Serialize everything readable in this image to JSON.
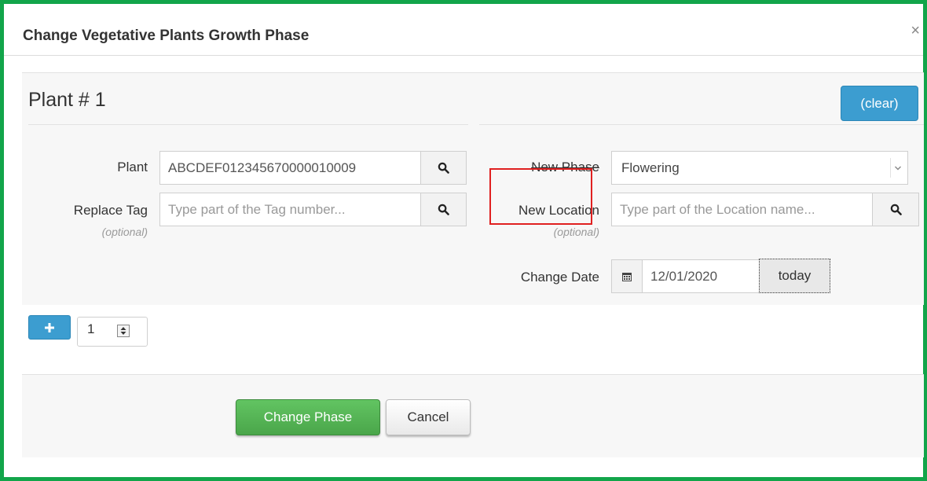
{
  "dialog": {
    "title": "Change Vegetative Plants Growth Phase",
    "close_symbol": "×"
  },
  "plant_section": {
    "heading": "Plant # 1",
    "clear_label": "(clear)"
  },
  "fields": {
    "plant": {
      "label": "Plant",
      "value": "ABCDEF012345670000010009"
    },
    "replace_tag": {
      "label": "Replace Tag",
      "optional": "(optional)",
      "placeholder": "Type part of the Tag number..."
    },
    "new_phase": {
      "label": "New Phase",
      "selected": "Flowering"
    },
    "new_location": {
      "label": "New Location",
      "optional": "(optional)",
      "placeholder": "Type part of the Location name..."
    },
    "change_date": {
      "label": "Change Date",
      "value": "12/01/2020",
      "today_label": "today"
    }
  },
  "add_rows": {
    "count": "1"
  },
  "footer": {
    "change_label": "Change Phase",
    "cancel_label": "Cancel"
  },
  "colors": {
    "frame_border": "#12a54a",
    "info_blue": "#3c9dd0",
    "success_green": "#4aa64a",
    "highlight_red": "#e02020"
  },
  "icons": {
    "search": "search-icon",
    "calendar": "calendar-icon",
    "plus": "plus-icon",
    "caret": "chevron-down-icon",
    "spin": "spin-arrows-icon"
  }
}
